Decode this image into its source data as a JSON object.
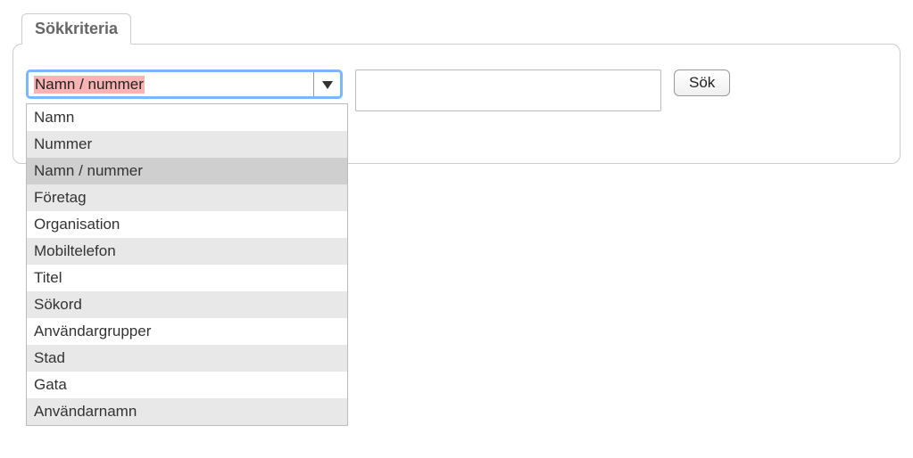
{
  "tab": {
    "label": "Sökkriteria"
  },
  "combo": {
    "selected": "Namn / nummer",
    "options": [
      "Namn",
      "Nummer",
      "Namn / nummer",
      "Företag",
      "Organisation",
      "Mobiltelefon",
      "Titel",
      "Sökord",
      "Användargrupper",
      "Stad",
      "Gata",
      "Användarnamn"
    ]
  },
  "search_input": {
    "value": ""
  },
  "search_button": {
    "label": "Sök"
  }
}
